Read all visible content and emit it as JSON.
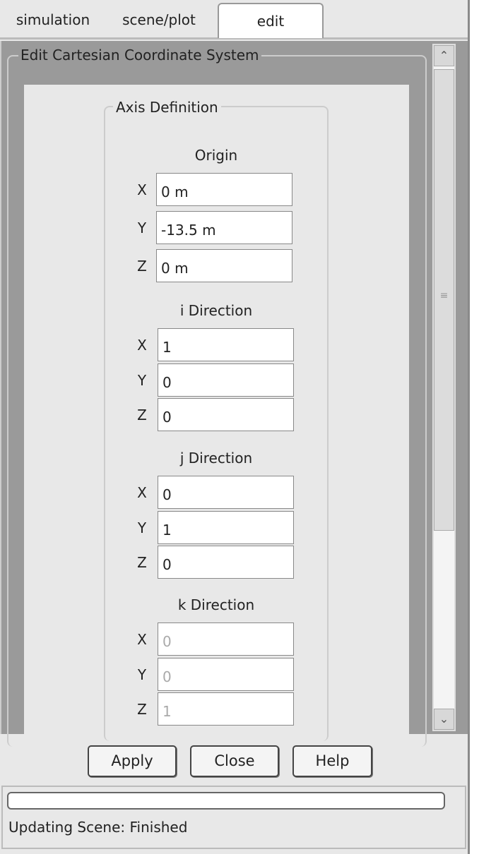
{
  "tabs": [
    {
      "label": "simulation",
      "active": false
    },
    {
      "label": "scene/plot",
      "active": false
    },
    {
      "label": "edit",
      "active": true
    }
  ],
  "group_title": "Edit Cartesian Coordinate System",
  "fieldset_title": "Axis Definition",
  "sections": [
    {
      "title": "Origin",
      "fields": [
        {
          "axis": "X",
          "value": "0 m"
        },
        {
          "axis": "Y",
          "value": "-13.5 m"
        },
        {
          "axis": "Z",
          "value": "0 m"
        }
      ],
      "enabled": true
    },
    {
      "title": "i Direction",
      "fields": [
        {
          "axis": "X",
          "value": "1"
        },
        {
          "axis": "Y",
          "value": "0"
        },
        {
          "axis": "Z",
          "value": "0"
        }
      ],
      "enabled": true
    },
    {
      "title": "j Direction",
      "fields": [
        {
          "axis": "X",
          "value": "0"
        },
        {
          "axis": "Y",
          "value": "1"
        },
        {
          "axis": "Z",
          "value": "0"
        }
      ],
      "enabled": true
    },
    {
      "title": "k Direction",
      "fields": [
        {
          "axis": "X",
          "value": "0"
        },
        {
          "axis": "Y",
          "value": "0"
        },
        {
          "axis": "Z",
          "value": "1"
        }
      ],
      "enabled": false
    }
  ],
  "buttons": {
    "apply": "Apply",
    "close": "Close",
    "help": "Help"
  },
  "progress": 0,
  "status_text": "Updating Scene: Finished",
  "icons": {
    "scroll_up": "chevron-up-icon",
    "scroll_down": "chevron-down-icon",
    "grip": "scrollbar-grip-icon"
  }
}
